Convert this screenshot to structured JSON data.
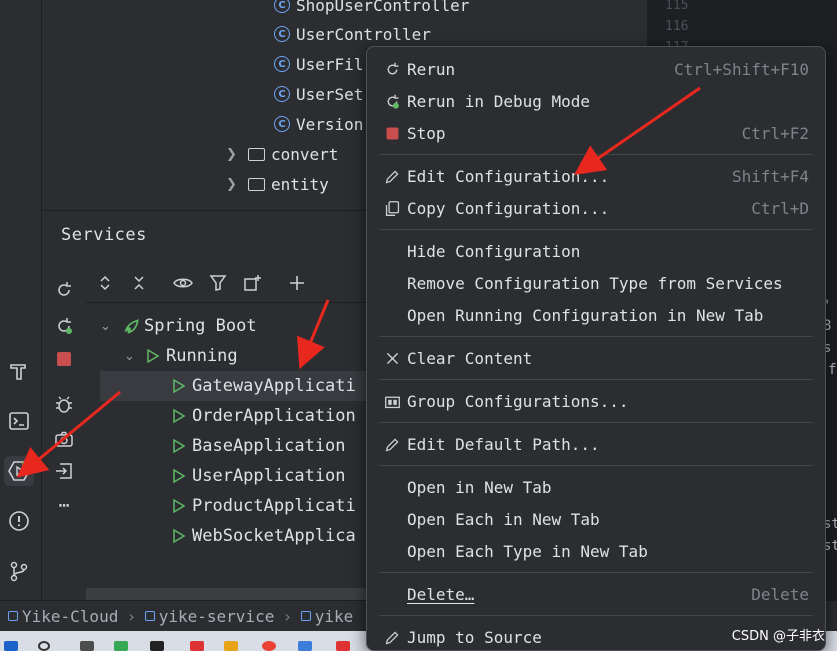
{
  "project_tree": {
    "items": [
      {
        "label": "ShopUserController",
        "kind": "class"
      },
      {
        "label": "UserController",
        "kind": "class"
      },
      {
        "label": "UserFil",
        "kind": "class"
      },
      {
        "label": "UserSet",
        "kind": "class"
      },
      {
        "label": "Version",
        "kind": "class"
      },
      {
        "label": "convert",
        "kind": "package"
      },
      {
        "label": "entity",
        "kind": "package"
      }
    ]
  },
  "editor": {
    "line_numbers": [
      "115",
      "116",
      "117"
    ],
    "right_code": [
      "'",
      "8",
      "s",
      "f",
      "st",
      "st"
    ]
  },
  "services": {
    "title": "Services",
    "tree": {
      "root": "Spring Boot",
      "group": "Running",
      "apps": [
        "GatewayApplicati",
        "OrderApplication",
        "BaseApplication",
        "UserApplication",
        "ProductApplicati",
        "WebSocketApplica"
      ],
      "selected_index": 0
    }
  },
  "breadcrumb": {
    "items": [
      "Yike-Cloud",
      "yike-service",
      "yike"
    ]
  },
  "context_menu": {
    "items": [
      {
        "label": "Rerun",
        "shortcut": "Ctrl+Shift+F10",
        "icon": "rerun-icon"
      },
      {
        "label": "Rerun in Debug Mode",
        "shortcut": "",
        "icon": "rerun-debug-icon"
      },
      {
        "label": "Stop",
        "shortcut": "Ctrl+F2",
        "icon": "stop-icon"
      },
      {
        "label": "Edit Configuration...",
        "shortcut": "Shift+F4",
        "icon": "pencil-icon"
      },
      {
        "label": "Copy Configuration...",
        "shortcut": "Ctrl+D",
        "icon": "copy-icon"
      },
      {
        "label": "Hide Configuration",
        "shortcut": "",
        "icon": ""
      },
      {
        "label": "Remove Configuration Type from Services",
        "shortcut": "",
        "icon": ""
      },
      {
        "label": "Open Running Configuration in New Tab",
        "shortcut": "",
        "icon": ""
      },
      {
        "label": "Clear Content",
        "shortcut": "",
        "icon": "close-icon"
      },
      {
        "label": "Group Configurations...",
        "shortcut": "",
        "icon": "group-icon"
      },
      {
        "label": "Edit Default Path...",
        "shortcut": "",
        "icon": "pencil-icon"
      },
      {
        "label": "Open in New Tab",
        "shortcut": "",
        "icon": ""
      },
      {
        "label": "Open Each in New Tab",
        "shortcut": "",
        "icon": ""
      },
      {
        "label": "Open Each Type in New Tab",
        "shortcut": "",
        "icon": ""
      },
      {
        "label": "Delete…",
        "shortcut": "Delete",
        "icon": ""
      },
      {
        "label": "Jump to Source",
        "shortcut": "",
        "icon": "pencil-icon"
      }
    ]
  },
  "watermark": "CSDN @子非衣",
  "colors": {
    "background": "#2b2d30",
    "editor_bg": "#1e1f22",
    "accent_blue": "#6fa4f5",
    "run_green": "#5fb865",
    "stop_red": "#c94f4f",
    "arrow_red": "#e8281e"
  }
}
